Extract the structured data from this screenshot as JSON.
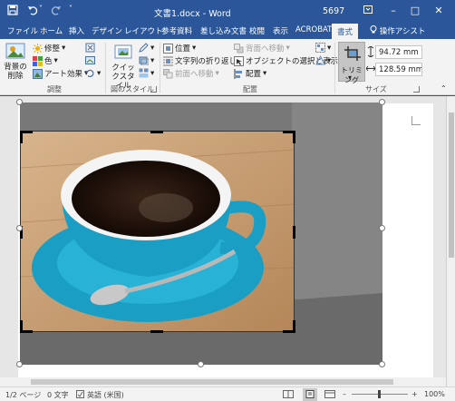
{
  "titlebar": {
    "save_icon": "save-icon",
    "undo_icon": "undo-icon",
    "redo_icon": "redo-icon",
    "qa_menu": "˅",
    "title": "文書1.docx - Word",
    "user": "5697",
    "minimize": "–",
    "maximize": "□",
    "close": "✕"
  },
  "tabs": [
    {
      "label": "ファイル"
    },
    {
      "label": "ホーム"
    },
    {
      "label": "挿入"
    },
    {
      "label": "デザイン"
    },
    {
      "label": "レイアウト"
    },
    {
      "label": "参考資料"
    },
    {
      "label": "差し込み文書"
    },
    {
      "label": "校閲"
    },
    {
      "label": "表示"
    },
    {
      "label": "ACROBAT"
    },
    {
      "label": "書式"
    },
    {
      "label": "操作アシスト"
    }
  ],
  "ribbon": {
    "remove_bg": "背景の削除",
    "corrections": "修整",
    "color": "色",
    "artistic": "アート効果",
    "group_adjust": "調整",
    "quick_styles": "クイックスタイル",
    "group_styles": "図のスタイル",
    "position": "位置",
    "wrap_text": "文字列の折り返し",
    "bring_forward": "前面へ移動",
    "send_backward": "背面へ移動",
    "selection_pane": "オブジェクトの選択と表示",
    "align": "配置",
    "group_arrange": "配置",
    "crop": "トリミング",
    "height": "94.72 mm",
    "width": "128.59 mm",
    "group_size": "サイズ"
  },
  "status": {
    "page": "1/2 ページ",
    "words": "0 文字",
    "language": "英語 (米国)",
    "zoom_minus": "–",
    "zoom_plus": "+",
    "zoom": "100%"
  },
  "colors": {
    "accent": "#2b579a",
    "ribbon_bg": "#f3f3f3",
    "cup": "#1a9ec4",
    "table": "#c8a27a"
  }
}
